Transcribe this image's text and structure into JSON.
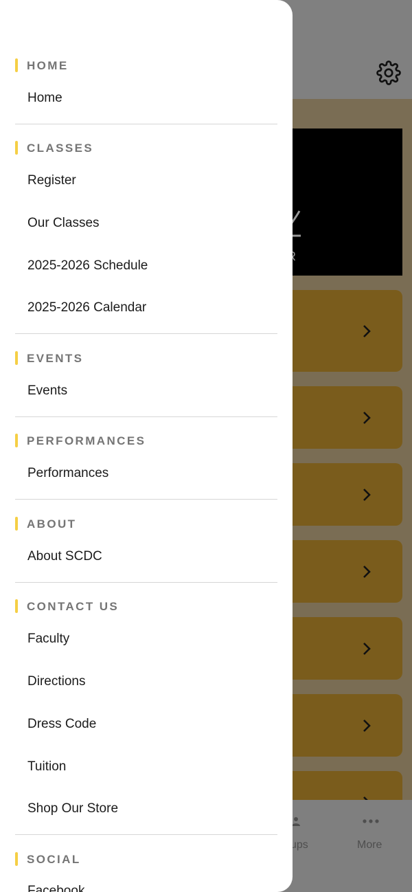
{
  "drawer": {
    "sections": [
      {
        "title": "HOME",
        "items": [
          "Home"
        ]
      },
      {
        "title": "CLASSES",
        "items": [
          "Register",
          "Our Classes",
          "2025-2026 Schedule",
          "2025-2026 Calendar"
        ]
      },
      {
        "title": "EVENTS",
        "items": [
          "Events"
        ]
      },
      {
        "title": "PERFORMANCES",
        "items": [
          "Performances"
        ]
      },
      {
        "title": "ABOUT",
        "items": [
          "About SCDC"
        ]
      },
      {
        "title": "CONTACT US",
        "items": [
          "Faculty",
          "Directions",
          "Dress Code",
          "Tuition",
          "Shop Our Store"
        ]
      },
      {
        "title": "SOCIAL",
        "items": [
          "Facebook"
        ]
      }
    ]
  },
  "background": {
    "hero_letter": "R",
    "tabbar": {
      "tab_partial_label": "ups",
      "more_label": "More"
    }
  },
  "colors": {
    "section_accent": "#f5cf45",
    "card": "#7a5c1c",
    "overlay_bg": "#7a6d54"
  },
  "icons": {
    "settings": "gear-icon",
    "card_arrow": "chevron-right-icon",
    "more": "more-dots-icon"
  }
}
